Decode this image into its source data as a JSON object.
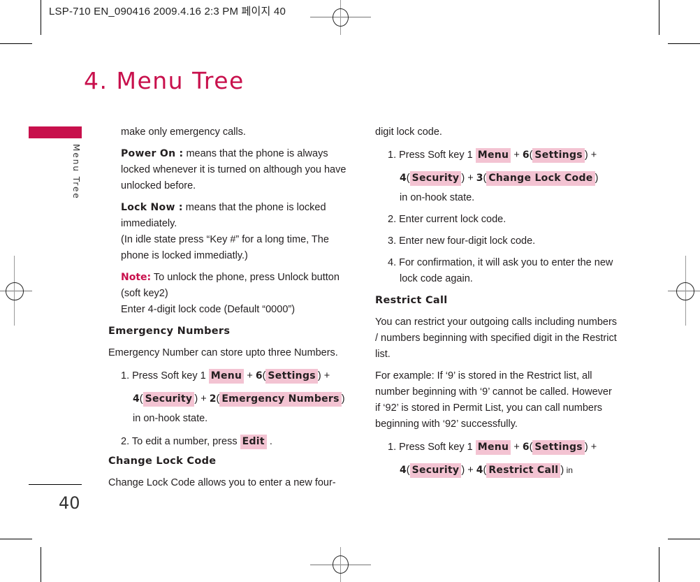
{
  "slug": "LSP-710 EN_090416  2009.4.16 2:3 PM  페이지 40",
  "chapter_title": "4. Menu Tree",
  "side_label": "Menu Tree",
  "page_number": "40",
  "colors": {
    "accent": "#c8104c",
    "key_highlight": "#f3c3d2"
  },
  "left": {
    "p1": "make only emergency calls.",
    "power_on": {
      "term": "Power On :",
      "text": " means that the phone is always locked whenever it is turned on although you have unlocked before."
    },
    "lock_now": {
      "term": "Lock Now :",
      "text": " means that the phone is locked immediately.",
      "extra": "(In idle state press “Key #” for a long time, The phone is locked immediatly.)"
    },
    "note": {
      "label": "Note:",
      "text": " To unlock the phone, press Unlock button (soft key2)",
      "extra": "Enter 4-digit lock code (Default “0000”)"
    },
    "emergency": {
      "heading": "Emergency Numbers",
      "desc": "Emergency Number can store upto three Numbers.",
      "step1": {
        "prefix": "1. Press Soft key 1 ",
        "k1": "Menu",
        "plus1": " + ",
        "n1": "6",
        "k2": "Settings",
        "plus2": ") +",
        "n2": "4",
        "k3": "Security",
        "plus3": ") + ",
        "n3": "2",
        "k4": "Emergency Numbers",
        "suffix": "in on-hook state."
      },
      "step2": {
        "prefix": "2. To edit a number, press ",
        "k1": "Edit",
        "suffix": " ."
      }
    },
    "change_lock": {
      "heading": "Change Lock Code",
      "desc": "Change Lock Code allows you to enter a new four-"
    }
  },
  "right": {
    "p1": "digit lock code.",
    "step1": {
      "prefix": "1. Press Soft key 1 ",
      "k1": "Menu",
      "n1": "6",
      "k2": "Settings",
      "n2": "4",
      "k3": "Security",
      "n3": "3",
      "k4": "Change Lock Code",
      "suffix": "in on-hook state."
    },
    "step2": "2. Enter current lock code.",
    "step3": "3. Enter new four-digit lock code.",
    "step4": "4. For confirmation, it will ask you to enter the new lock code again.",
    "restrict": {
      "heading": "Restrict Call",
      "desc": "You can restrict your outgoing calls including numbers / numbers beginning with specified digit in the Restrict list.",
      "example": "For example: If  ‘9’ is stored in the Restrict list, all number beginning with ‘9’ cannot be called. However if  ‘92’ is stored in Permit List, you can call numbers beginning with ‘92’ successfully.",
      "step1": {
        "prefix": "1. Press Soft key 1 ",
        "k1": "Menu",
        "n1": "6",
        "k2": "Settings",
        "n2": "4",
        "k3": "Security",
        "n3": "4",
        "k4": "Restrict Call",
        "suffix": " in"
      }
    }
  }
}
